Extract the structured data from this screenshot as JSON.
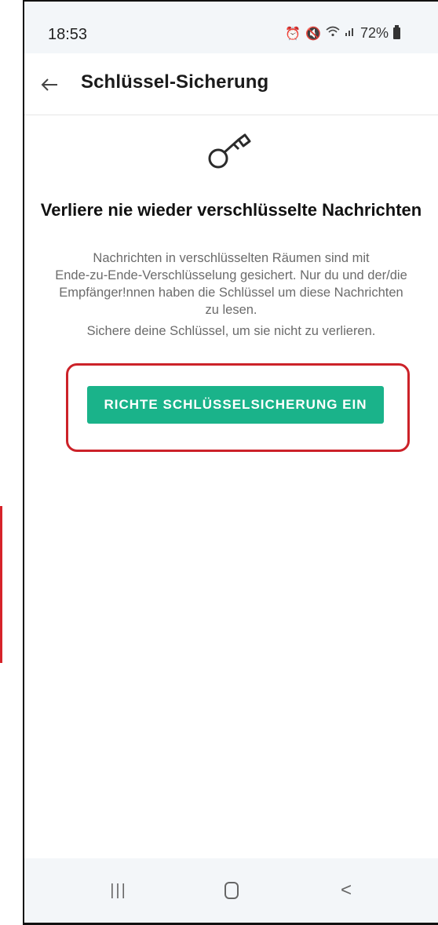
{
  "status_bar": {
    "time": "18:53",
    "battery": "72%",
    "icons": [
      "alarm-icon",
      "mute-icon",
      "wifi-icon",
      "signal-icon",
      "battery-icon"
    ]
  },
  "app_bar": {
    "back_icon": "back-arrow-icon",
    "title": "Schlüssel-Sicherung"
  },
  "content": {
    "icon": "key-icon",
    "headline": "Verliere nie wieder verschlüsselte Nachrichten",
    "body_lines": [
      "Nachrichten in verschlüsselten Räumen sind mit",
      "Ende-zu-Ende-Verschlüsselung gesichert. Nur du und der/die",
      "Empfänger!nnen haben die Schlüssel um diese Nachrichten",
      "zu lesen."
    ],
    "body_2": "Sichere deine Schlüssel, um sie nicht zu verlieren.",
    "button_label": "RICHTE SCHLÜSSELSICHERUNG EIN",
    "button_color": "#1ab38a",
    "highlight_color": "#cc2229"
  },
  "nav_bar": {
    "recents_glyph": "|||",
    "back_glyph": "<"
  }
}
